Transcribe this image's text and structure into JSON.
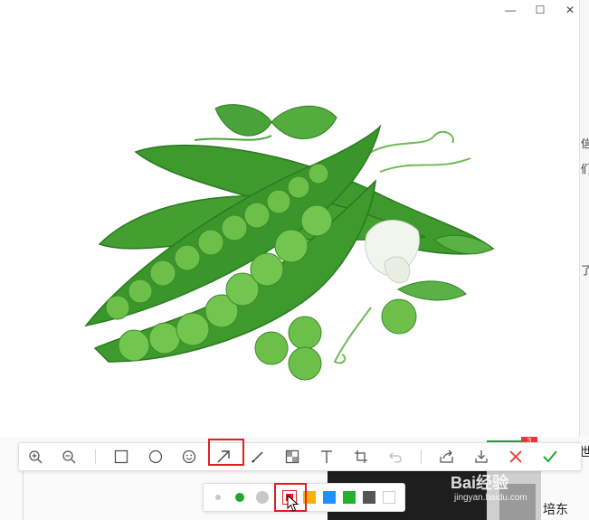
{
  "window": {
    "controls": [
      {
        "name": "minimize-button",
        "glyph": "—"
      },
      {
        "name": "maximize-button",
        "glyph": "☐"
      },
      {
        "name": "close-window-button",
        "glyph": "✕"
      }
    ]
  },
  "image": {
    "subject": "peas",
    "colors": {
      "pod": "#3e9a2c",
      "pod_dark": "#2a7a1f",
      "pea": "#6cc04a",
      "leaf": "#4aa33a",
      "flower": "#f2f5ee"
    }
  },
  "toolbar": {
    "tools": [
      {
        "name": "zoom-in-button",
        "icon": "zoom-in-icon"
      },
      {
        "name": "zoom-out-button",
        "icon": "zoom-out-icon"
      },
      {
        "name": "rectangle-tool-button",
        "icon": "rectangle-icon"
      },
      {
        "name": "ellipse-tool-button",
        "icon": "ellipse-icon"
      },
      {
        "name": "emoji-tool-button",
        "icon": "emoji-icon"
      },
      {
        "name": "arrow-tool-button",
        "icon": "arrow-icon",
        "selected": true
      },
      {
        "name": "pen-tool-button",
        "icon": "pen-icon"
      },
      {
        "name": "mosaic-tool-button",
        "icon": "mosaic-icon"
      },
      {
        "name": "text-tool-button",
        "icon": "text-icon"
      },
      {
        "name": "crop-tool-button",
        "icon": "crop-icon"
      },
      {
        "name": "undo-button",
        "icon": "undo-icon",
        "disabled": true
      },
      {
        "name": "share-button",
        "icon": "share-icon"
      },
      {
        "name": "download-button",
        "icon": "download-icon"
      },
      {
        "name": "cancel-button",
        "icon": "close-icon"
      },
      {
        "name": "confirm-button",
        "icon": "check-icon"
      }
    ],
    "colors": {
      "icon": "#555555",
      "cancel": "#e53935",
      "confirm": "#22a52b",
      "highlight": "#e02020"
    }
  },
  "color_palette": {
    "sizes": [
      "small",
      "medium",
      "large"
    ],
    "size_colors": [
      "#c8c8c8",
      "#22a52b",
      "#c8c8c8"
    ],
    "swatches": [
      "#e02020",
      "#f5b400",
      "#1e90ff",
      "#22b22b",
      "#555555",
      "#ffffff"
    ],
    "selected_swatch": 0
  },
  "background": {
    "right_chars": [
      "信",
      "们",
      "了",
      "世"
    ],
    "bottom_label": "培东",
    "watermark": "Bai经验",
    "watermark_sub": "jingyan.baidu.com",
    "badge": "3"
  }
}
